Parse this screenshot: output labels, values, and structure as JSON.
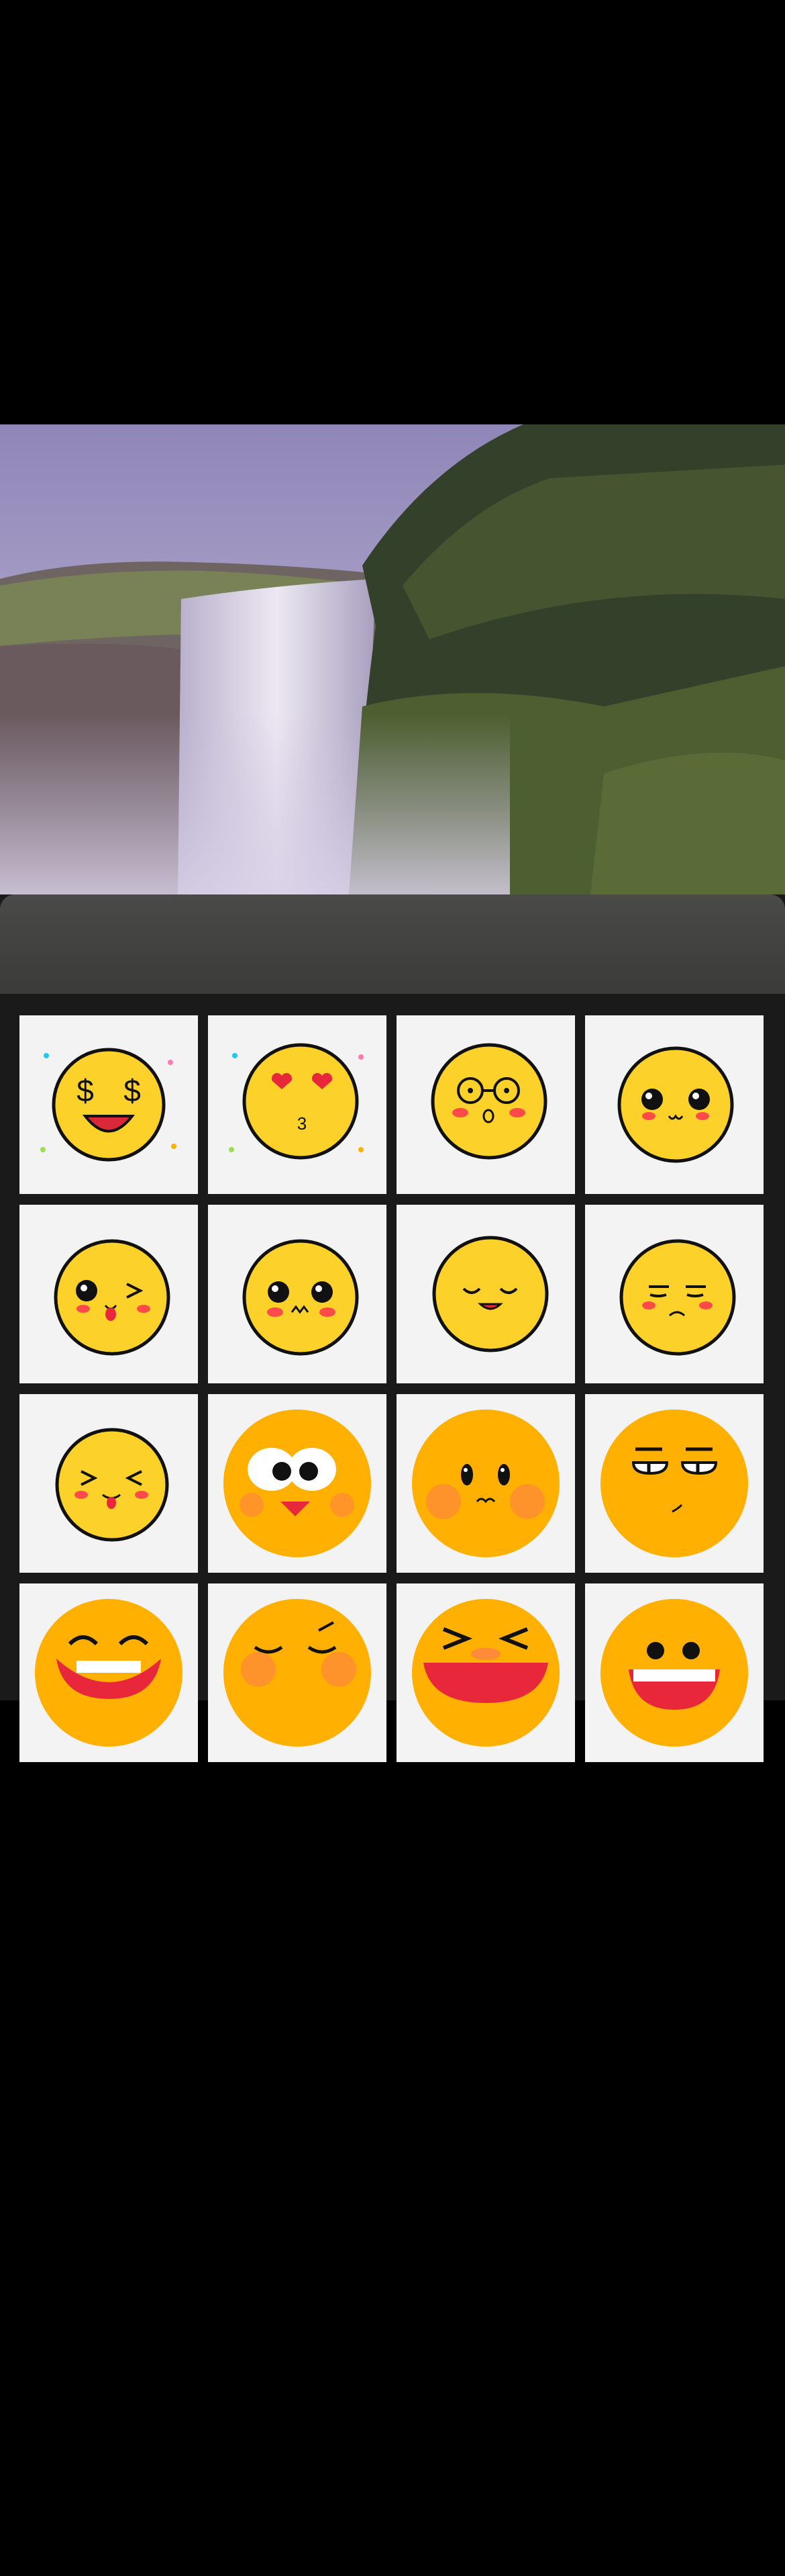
{
  "screen": {
    "background_color": "#000000",
    "sheet_color": "#1a1a1a",
    "sheet_header_color": "#454543",
    "tile_background": "#f3f3f3",
    "emoji_yellow": "#fcd22a",
    "emoji_orange": "#ffb000"
  },
  "photo": {
    "subject": "waterfall-landscape"
  },
  "sticker_grid": {
    "stickers": [
      {
        "icon": "money-eyes-emoji-icon"
      },
      {
        "icon": "heart-eyes-kiss-emoji-icon"
      },
      {
        "icon": "glasses-surprised-emoji-icon"
      },
      {
        "icon": "cute-smile-emoji-icon"
      },
      {
        "icon": "wink-tongue-emoji-icon"
      },
      {
        "icon": "pout-emoji-icon"
      },
      {
        "icon": "content-closed-eyes-emoji-icon"
      },
      {
        "icon": "unamused-emoji-icon"
      },
      {
        "icon": "squint-tongue-emoji-icon"
      },
      {
        "icon": "big-eyes-beak-emoji-icon"
      },
      {
        "icon": "blush-pout-emoji-icon"
      },
      {
        "icon": "side-eye-emoji-icon"
      },
      {
        "icon": "laughing-emoji-icon"
      },
      {
        "icon": "smirk-emoji-icon"
      },
      {
        "icon": "squint-laugh-emoji-icon"
      },
      {
        "icon": "open-mouth-emoji-icon"
      }
    ]
  }
}
